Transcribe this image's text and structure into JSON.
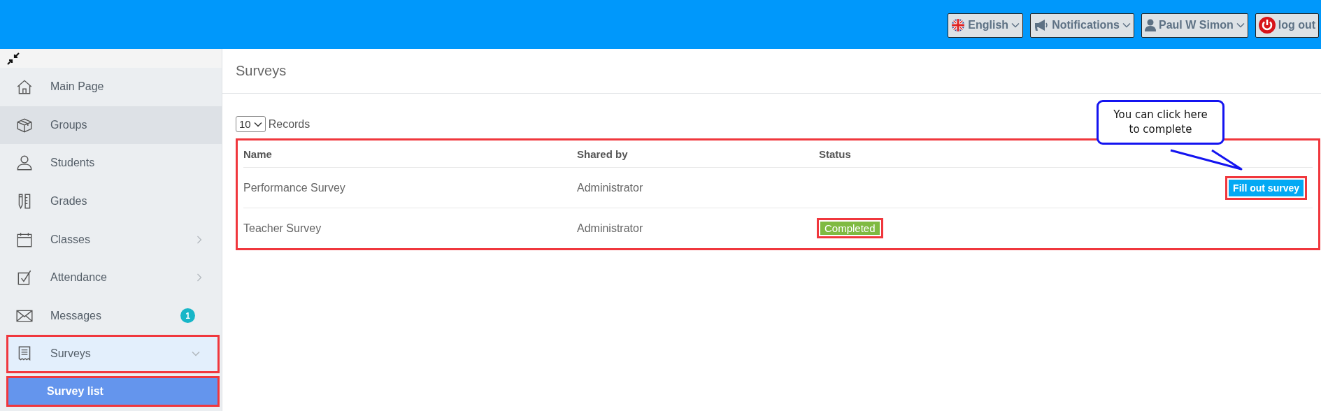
{
  "topbar": {
    "buttons": [
      {
        "kind": "language",
        "label": "English",
        "dropdown": true
      },
      {
        "kind": "notifications",
        "label": "Notifications",
        "dropdown": true
      },
      {
        "kind": "user",
        "label": "Paul W Simon",
        "dropdown": true
      },
      {
        "kind": "logout",
        "label": "log out",
        "dropdown": false
      }
    ]
  },
  "sidebar": {
    "items": [
      {
        "kind": "link",
        "label": "Main Page",
        "hovered": false,
        "highlighted": false
      },
      {
        "kind": "link",
        "label": "Groups",
        "hovered": true,
        "highlighted": false
      },
      {
        "kind": "link",
        "label": "Students",
        "hovered": false,
        "highlighted": false
      },
      {
        "kind": "link",
        "label": "Grades",
        "hovered": false,
        "highlighted": false
      },
      {
        "kind": "submenu",
        "label": "Classes",
        "expanded": false,
        "hovered": false,
        "highlighted": false
      },
      {
        "kind": "submenu",
        "label": "Attendance",
        "expanded": false,
        "hovered": false,
        "highlighted": false
      },
      {
        "kind": "link",
        "label": "Messages",
        "badge": "1",
        "hovered": false,
        "highlighted": false
      },
      {
        "kind": "submenu",
        "label": "Surveys",
        "expanded": true,
        "hovered": false,
        "highlighted": true,
        "children": [
          {
            "label": "Survey list",
            "selected": true,
            "highlighted": true
          }
        ]
      }
    ]
  },
  "page": {
    "title": "Surveys",
    "records": {
      "value": "10",
      "label": "Records"
    },
    "table": {
      "highlighted": true,
      "columns": [
        "Name",
        "Shared by",
        "Status"
      ],
      "rows": [
        {
          "name": "Performance Survey",
          "shared_by": "Administrator",
          "action": {
            "label": "Fill out survey",
            "highlighted": true
          }
        },
        {
          "name": "Teacher Survey",
          "shared_by": "Administrator",
          "status": {
            "label": "Completed",
            "highlighted": true
          }
        }
      ]
    },
    "callout": {
      "text": "You can click here to complete"
    }
  }
}
